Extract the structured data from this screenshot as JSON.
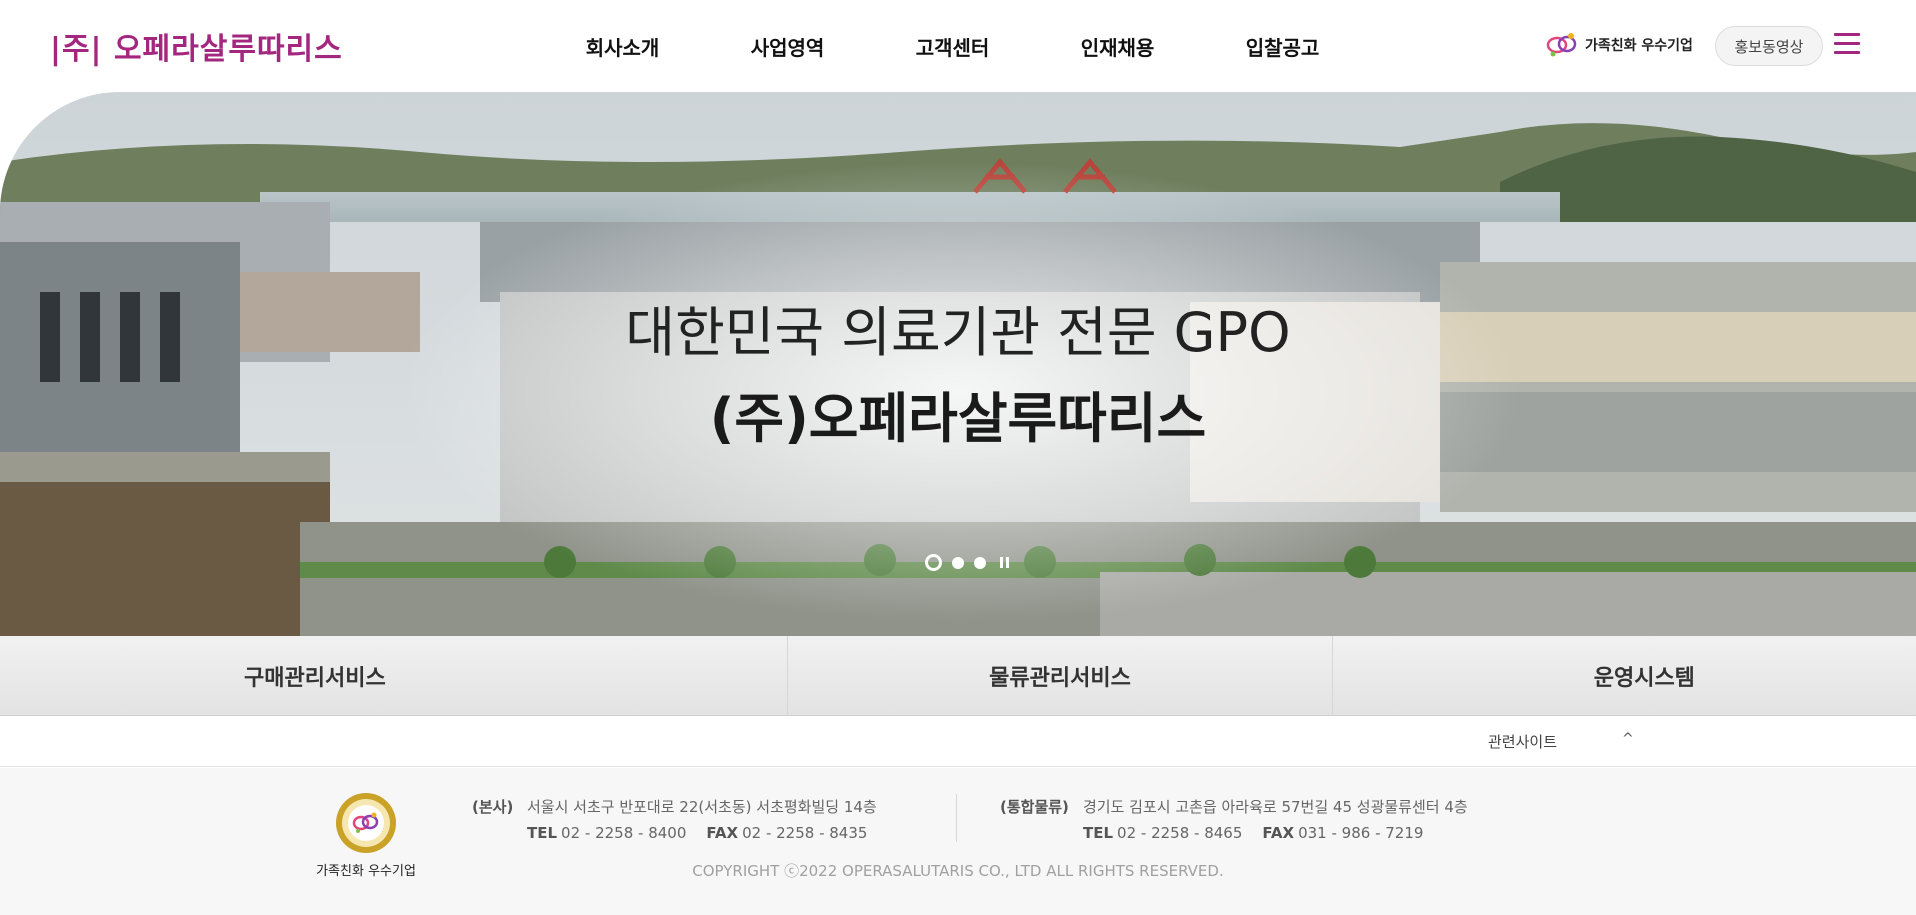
{
  "header": {
    "logo": "|주| 오페라살루따리스",
    "nav": [
      "회사소개",
      "사업영역",
      "고객센터",
      "인재채용",
      "입찰공고"
    ],
    "family_badge": "가족친화 우수기업",
    "promo_video": "홍보동영상"
  },
  "hero": {
    "title_line1": "대한민국 의료기관 전문 GPO",
    "title_line2": "(주)오페라살루따리스",
    "slides": 3,
    "active_slide": 1
  },
  "services": [
    "구매관리서비스",
    "물류관리서비스",
    "운영시스템"
  ],
  "related": {
    "label": "관련사이트",
    "caret": "^"
  },
  "footer": {
    "family_label": "가족친화 우수기업",
    "hq": {
      "label": "(본사)",
      "address": "서울시 서초구 반포대로 22(서초동) 서초평화빌딩 14층",
      "tel_label": "TEL",
      "tel": "02 - 2258 - 8400",
      "fax_label": "FAX",
      "fax": "02 - 2258 - 8435"
    },
    "logistics": {
      "label": "(통합물류)",
      "address": "경기도 김포시 고촌읍 아라육로 57번길 45 성광물류센터 4층",
      "tel_label": "TEL",
      "tel": "02 - 2258 - 8465",
      "fax_label": "FAX",
      "fax": "031 - 986 - 7219"
    },
    "copyright": "COPYRIGHT ⓒ2022 OPERASALUTARIS CO., LTD ALL RIGHTS RESERVED."
  },
  "colors": {
    "brand": "#a3267f",
    "text": "#222222",
    "footer_bg": "#f7f7f7"
  }
}
